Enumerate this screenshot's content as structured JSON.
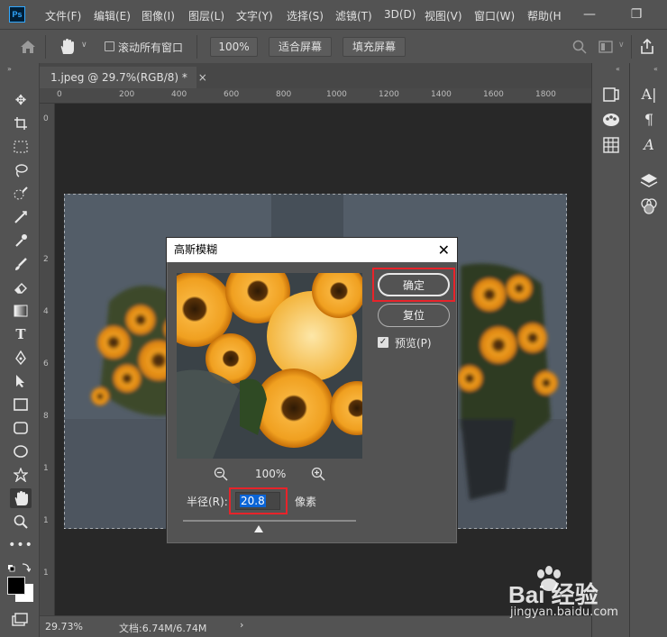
{
  "app": {
    "logo": "Ps"
  },
  "menu": [
    "文件(F)",
    "编辑(E)",
    "图像(I)",
    "图层(L)",
    "文字(Y)",
    "选择(S)",
    "滤镜(T)",
    "3D(D)",
    "视图(V)",
    "窗口(W)",
    "帮助(H"
  ],
  "window_controls": {
    "minimize": "—",
    "restore": "❐"
  },
  "options_bar": {
    "scroll_all_windows_label": "滚动所有窗口",
    "zoom_label": "100%",
    "fit_screen_label": "适合屏幕",
    "fill_screen_label": "填充屏幕"
  },
  "document": {
    "tab_title": "1.jpeg @ 29.7%(RGB/8) *",
    "tab_close": "×",
    "ruler_top": [
      "0",
      "200",
      "400",
      "600",
      "800",
      "1000",
      "1200",
      "1400",
      "1600",
      "1800"
    ],
    "ruler_left": [
      "0",
      "2",
      "4",
      "6",
      "8",
      "1",
      "1",
      "1"
    ]
  },
  "status": {
    "zoom": "29.73%",
    "doc_info": "文档:6.74M/6.74M",
    "arrow": "›"
  },
  "dialog": {
    "title": "高斯模糊",
    "ok_label": "确定",
    "reset_label": "复位",
    "preview_label": "预览(P)",
    "preview_checked": true,
    "zoom_out_icon": "zoom-out-icon",
    "zoom_in_icon": "zoom-in-icon",
    "zoom_percent": "100%",
    "radius_label": "半径(R):",
    "radius_value": "20.8",
    "radius_unit": "像素"
  },
  "watermark": {
    "brand": "Bai 经验",
    "url": "jingyan.baidu.com"
  },
  "colors": {
    "highlight": "#e8232a",
    "panel": "#535353",
    "canvas": "#282828",
    "selection": "#0a64d6"
  }
}
